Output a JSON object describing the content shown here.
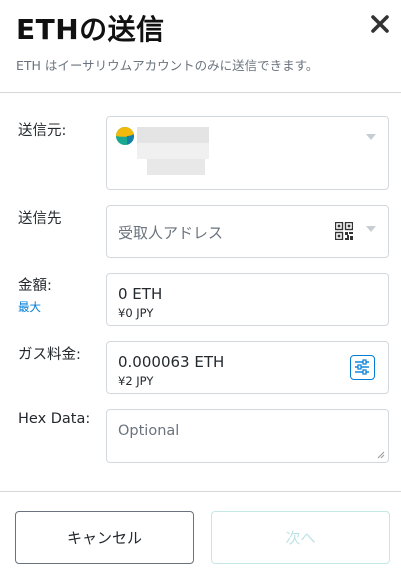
{
  "header": {
    "title": "ETHの送信",
    "subtitle": "ETH はイーサリウムアカウントのみに送信できます。"
  },
  "form": {
    "from": {
      "label": "送信元:"
    },
    "to": {
      "label": "送信先",
      "placeholder": "受取人アドレス"
    },
    "amount": {
      "label": "金額:",
      "max_link": "最大",
      "value": "0  ETH",
      "fiat": "¥0 JPY"
    },
    "gas": {
      "label": "ガス料金:",
      "value": "0.000063  ETH",
      "fiat": "¥2 JPY"
    },
    "hex": {
      "label": "Hex Data:",
      "placeholder": "Optional"
    }
  },
  "footer": {
    "cancel_label": "キャンセル",
    "next_label": "次へ"
  },
  "colors": {
    "accent": "#037dd6",
    "disabled_teal": "#c3e8e6",
    "account_icon_yellow": "#f0b90b",
    "account_icon_teal": "#1aa891"
  },
  "icons": [
    "close-icon",
    "account-identicon",
    "chevron-down-icon",
    "qr-code-icon",
    "gas-settings-icon"
  ]
}
